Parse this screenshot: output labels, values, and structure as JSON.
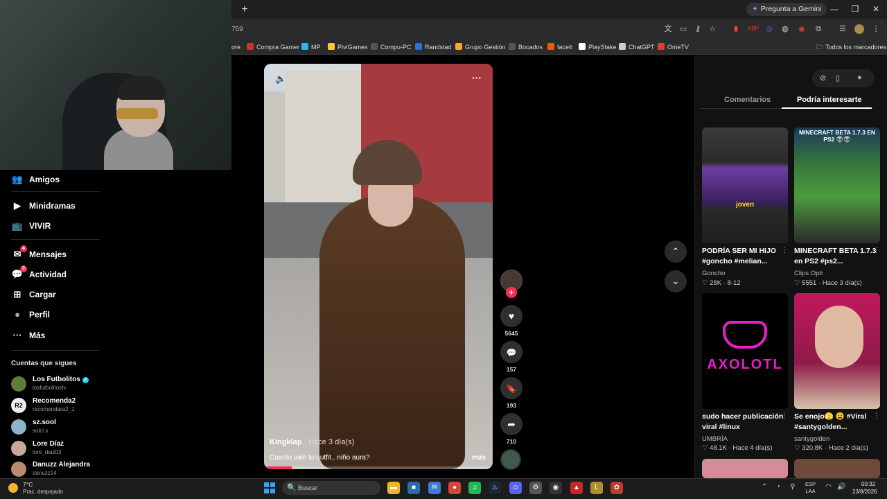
{
  "browser": {
    "new_tab_symbol": "+",
    "gemini_label": "Pregunta a Gemini",
    "url_fragment": "759",
    "window_controls": [
      "—",
      "❐",
      "✕"
    ],
    "bookmarks": [
      {
        "label": "ore",
        "color": "#444"
      },
      {
        "label": "Compra Gamer",
        "color": "#d32f2f"
      },
      {
        "label": "MP",
        "color": "#29b6f6"
      },
      {
        "label": "PiviGames",
        "color": "#ffca28"
      },
      {
        "label": "Compu-PC",
        "color": "#555"
      },
      {
        "label": "Randstad",
        "color": "#2175d9"
      },
      {
        "label": "Grupo Gestión",
        "color": "#f9a825"
      },
      {
        "label": "Bocados",
        "color": "#555"
      },
      {
        "label": "faceit",
        "color": "#ff5500"
      },
      {
        "label": "PlayStake",
        "color": "#fff"
      },
      {
        "label": "ChatGPT",
        "color": "#ccc"
      },
      {
        "label": "OmeTV",
        "color": "#e53935"
      }
    ],
    "all_bookmarks": "Todos los marcadores"
  },
  "sidebar": {
    "items": [
      {
        "label": "Amigos",
        "icon": "👥"
      },
      {
        "label": "Minidramas",
        "icon": "▶"
      },
      {
        "label": "VIVIR",
        "icon": "📺"
      },
      {
        "label": "Mensajes",
        "icon": "✉",
        "badge": "4"
      },
      {
        "label": "Actividad",
        "icon": "💬",
        "badge": "3"
      },
      {
        "label": "Cargar",
        "icon": "⊞"
      },
      {
        "label": "Perfil",
        "icon": "●"
      },
      {
        "label": "Más",
        "icon": "···"
      }
    ],
    "following_title": "Cuentas que sigues",
    "accounts": [
      {
        "name": "Los Futbolitos",
        "handle": "losfutbolitostv",
        "verified": true,
        "color": "#5e7d3a"
      },
      {
        "name": "Recomenda2",
        "handle": "recomendara2_1",
        "verified": false,
        "color": "#eeeeee"
      },
      {
        "name": "sz.sool",
        "handle": "solci.s",
        "verified": false,
        "color": "#8fb3c9"
      },
      {
        "name": "Lore Díaz",
        "handle": "lore_diaz03",
        "verified": false,
        "color": "#c7a89a"
      },
      {
        "name": "Danuzz Alejandra",
        "handle": "danuzz14",
        "verified": false,
        "color": "#b98a6d"
      }
    ],
    "verified_mark": "✓",
    "r2_label": "R2"
  },
  "video": {
    "author": "Kingklap",
    "date": "· Hace 3 día(s)",
    "caption": "Cuanto vale tu outfit.. niño aura?",
    "more_label": "más",
    "mute_icon": "🔈",
    "more_icon": "···",
    "progress": 0.12
  },
  "actions": {
    "follow_symbol": "+",
    "like_icon": "♥",
    "likes": "5645",
    "comment_icon": "💬",
    "comments": "157",
    "save_icon": "🔖",
    "saves": "193",
    "share_icon": "➦",
    "shares": "710",
    "up_arrow": "⌃",
    "down_arrow": "⌄"
  },
  "panel": {
    "tab_comments": "Comentarios",
    "tab_interest": "Podría interesarte",
    "tool_icons": [
      "⊘",
      "▯",
      "●"
    ],
    "cards": [
      {
        "title": "PODRÍA SER MI HIJO #goncho #melian...",
        "author": "Goncho",
        "stats": "♡ 28K · 8-12",
        "overlay": "joven",
        "bg": "linear-gradient(#3a3a3a 0%, #2b2b2b 30%, #6b3fa0 35%, #3a1f5e 65%, #2a2a2a 70%, #1f1f1f 100%)"
      },
      {
        "title": "MINECRAFT BETA 1.7.3 en PS2 #ps2...",
        "author": "Clips Opti",
        "stats": "♡ 5551 · Hace 3 día(s)",
        "overlay": "MINECRAFT BETA 1.7.3 EN PS2 👽👽",
        "bg": "linear-gradient(#1b3a5a 0%, #3a7d3a 35%, #4c9a3c 60%, #2a2a2a 100%)"
      },
      {
        "title": "sudo hacer publicación viral #linux",
        "author": "UMBRÍA",
        "stats": "♡ 48.1K · Hace 4 día(s)",
        "overlay": "AXOLOTL",
        "bg": "#000000"
      },
      {
        "title": "Se enojo🫣 😩 #Viral #santygolden...",
        "author": "santygolden",
        "stats": "♡ 320,8K · Hace 2 día(s)",
        "overlay": "",
        "bg": "linear-gradient(#c2185b 0%, #8e1b4a 60%, #d6c3a8 100%)"
      }
    ],
    "card_menu": "⋮"
  },
  "taskbar": {
    "weather_temp": "7°C",
    "weather_desc": "Prac. despejado",
    "search_placeholder": "Buscar",
    "search_icon": "🔍",
    "tray_lang": "ESP",
    "tray_lang2": "LAA",
    "time": "00:32",
    "date": "23/8/2026",
    "apps": [
      {
        "name": "folder",
        "color": "#f0b429",
        "glyph": "▬"
      },
      {
        "name": "store",
        "color": "#2b6cb0",
        "glyph": "■"
      },
      {
        "name": "mail",
        "color": "#3a7bd5",
        "glyph": "✉"
      },
      {
        "name": "chrome",
        "color": "#db4437",
        "glyph": "●"
      },
      {
        "name": "spotify",
        "color": "#1db954",
        "glyph": "♫"
      },
      {
        "name": "steam",
        "color": "#1b2838",
        "glyph": "♨"
      },
      {
        "name": "discord",
        "color": "#5865f2",
        "glyph": "☺"
      },
      {
        "name": "settings",
        "color": "#555",
        "glyph": "⚙"
      },
      {
        "name": "github",
        "color": "#333",
        "glyph": "◉"
      },
      {
        "name": "game",
        "color": "#c62828",
        "glyph": "▲"
      },
      {
        "name": "lol",
        "color": "#b08d2c",
        "glyph": "L"
      },
      {
        "name": "app",
        "color": "#c0392b",
        "glyph": "✿"
      }
    ]
  }
}
